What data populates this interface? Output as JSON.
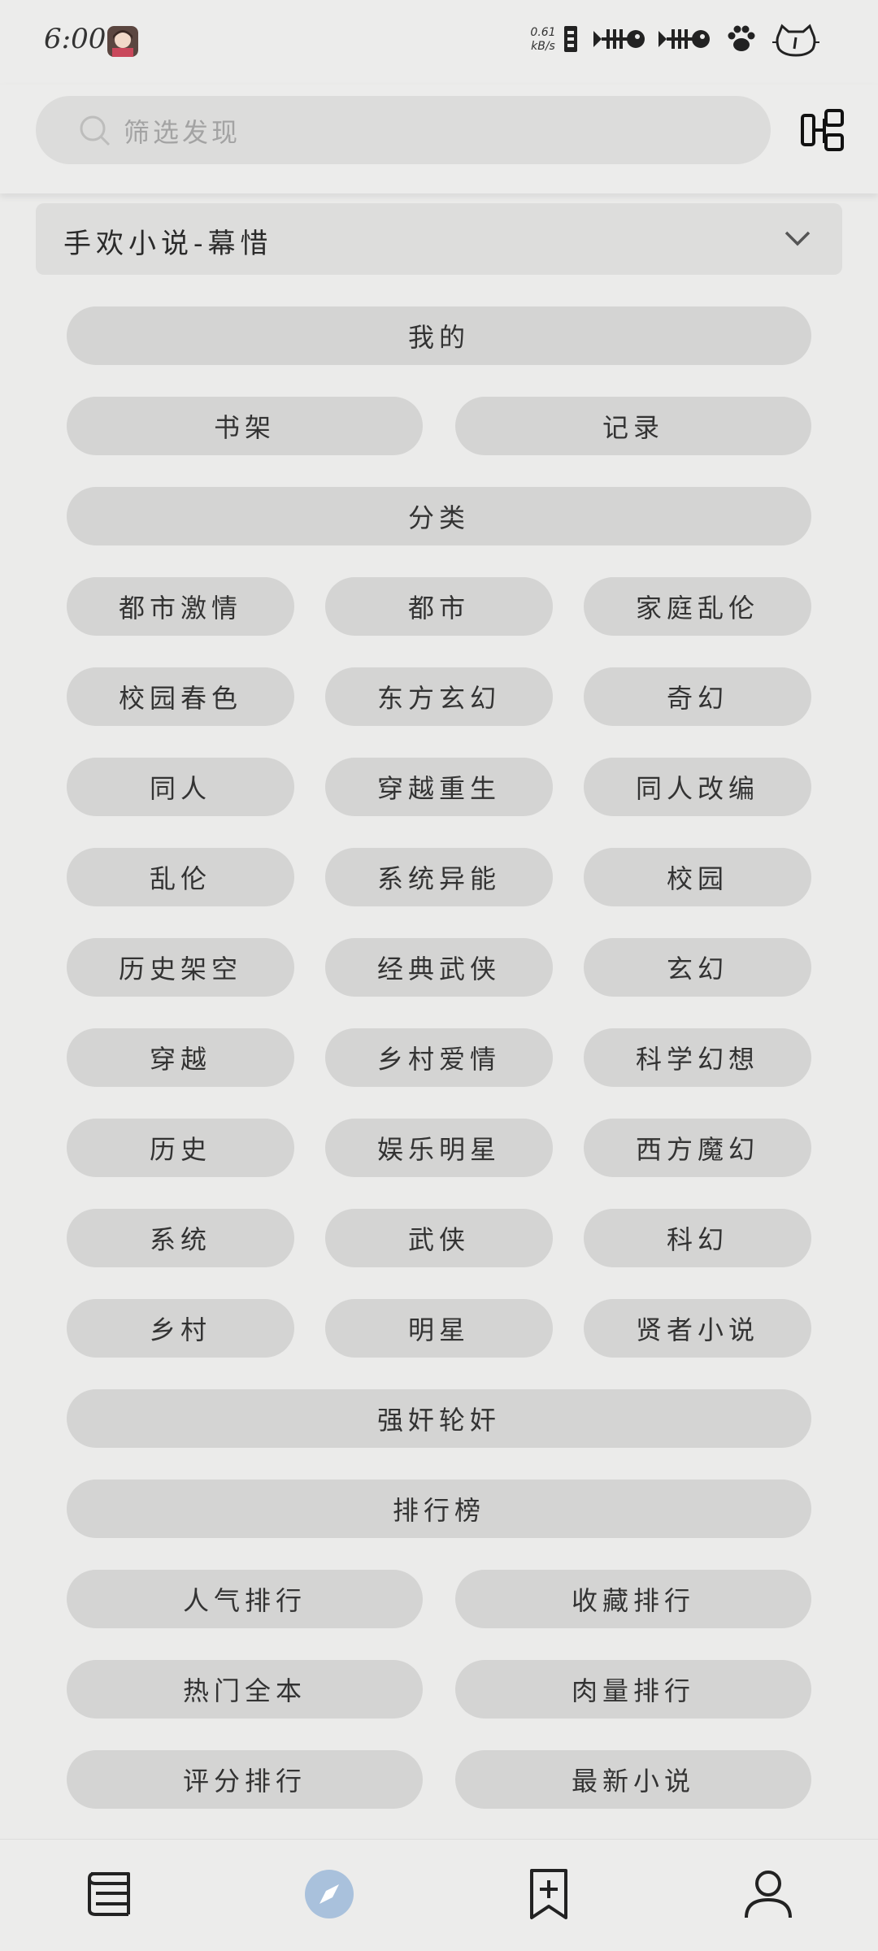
{
  "status_bar": {
    "time": "6:00",
    "net_speed_value": "0.61",
    "net_speed_unit": "kB/s",
    "icons": [
      "avatar",
      "sim-icon",
      "fishbone-icon",
      "fishbone-icon",
      "paw-icon",
      "cat-battery-icon"
    ]
  },
  "search": {
    "placeholder": "筛选发现"
  },
  "source": {
    "label": "手欢小说-幕惜"
  },
  "sections": {
    "mine": "我的",
    "mine_items": [
      "书架",
      "记录"
    ],
    "category": "分类",
    "category_items": [
      "都市激情",
      "都市",
      "家庭乱伦",
      "校园春色",
      "东方玄幻",
      "奇幻",
      "同人",
      "穿越重生",
      "同人改编",
      "乱伦",
      "系统异能",
      "校园",
      "历史架空",
      "经典武侠",
      "玄幻",
      "穿越",
      "乡村爱情",
      "科学幻想",
      "历史",
      "娱乐明星",
      "西方魔幻",
      "系统",
      "武侠",
      "科幻",
      "乡村",
      "明星",
      "贤者小说"
    ],
    "category_last": "强奸轮奸",
    "ranking": "排行榜",
    "ranking_items": [
      "人气排行",
      "收藏排行",
      "热门全本",
      "肉量排行",
      "评分排行",
      "最新小说"
    ]
  },
  "bottom_nav": {
    "items": [
      "bookshelf-icon",
      "explore-icon",
      "bookmark-add-icon",
      "profile-icon"
    ],
    "active_color": "#a9c1dc"
  }
}
